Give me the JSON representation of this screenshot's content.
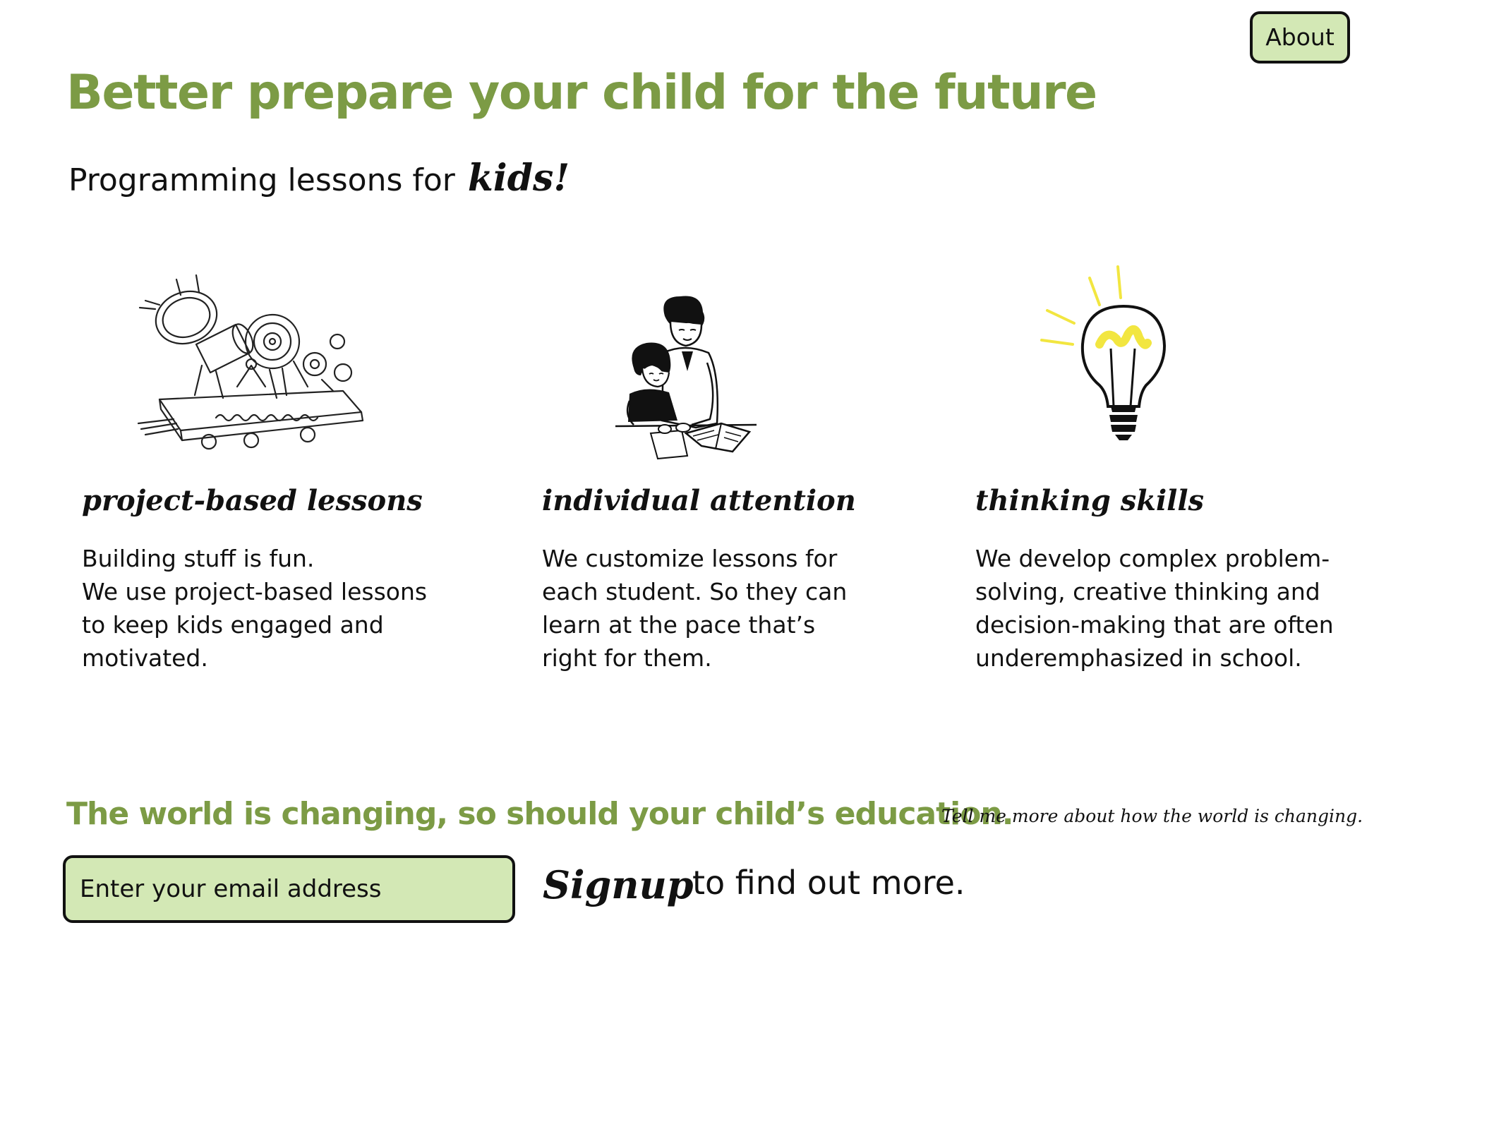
{
  "nav": {
    "about_label": "About"
  },
  "hero": {
    "headline": "Better prepare your child for the future",
    "subhead_prefix": "Programming lessons for",
    "subhead_emphasis": "kids!"
  },
  "features": [
    {
      "title": "project-based lessons",
      "lines": [
        "Building stuff is fun.",
        "We use project-based lessons",
        "to keep kids engaged and",
        "motivated."
      ],
      "illustration": "machine-illustration"
    },
    {
      "title": "individual attention",
      "lines": [
        "We customize lessons for",
        "each student. So they can",
        "learn at the pace that’s",
        "right for them."
      ],
      "illustration": "teacher-student-illustration"
    },
    {
      "title": "thinking skills",
      "lines": [
        "We develop complex problem-",
        "solving, creative thinking and",
        "decision-making that are often",
        "underemphasized in school."
      ],
      "illustration": "lightbulb-illustration"
    }
  ],
  "signup": {
    "tagline": "The world is changing, so should your child’s education.",
    "tell_more_link": "Tell me more about how the world is changing.",
    "email_placeholder": "Enter your email address",
    "signup_label": "Signup",
    "signup_suffix": "to find out more."
  },
  "colors": {
    "accent": "#7c9b45",
    "input_background": "#d3e8b5",
    "bulb_glow": "#f2e640"
  }
}
